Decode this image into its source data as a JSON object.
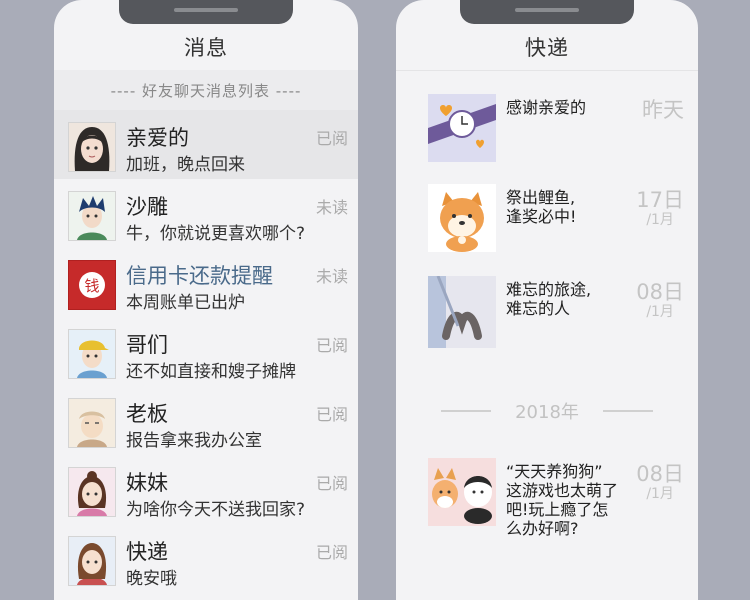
{
  "left_phone": {
    "title": "消息",
    "subtitle": "---- 好友聊天消息列表 ----",
    "items": [
      {
        "name": "亲爱的",
        "preview": "加班，晚点回来",
        "status": "已阅"
      },
      {
        "name": "沙雕",
        "preview": "牛，你就说更喜欢哪个?",
        "status": "未读"
      },
      {
        "name": "信用卡还款提醒",
        "preview": "本周账单已出炉",
        "status": "未读"
      },
      {
        "name": "哥们",
        "preview": "还不如直接和嫂子摊牌",
        "status": "已阅"
      },
      {
        "name": "老板",
        "preview": "报告拿来我办公室",
        "status": "已阅"
      },
      {
        "name": "妹妹",
        "preview": "为啥你今天不送我回家?",
        "status": "已阅"
      },
      {
        "name": "快递",
        "preview": "晚安哦",
        "status": "已阅"
      }
    ],
    "bank_icon_char": "钱"
  },
  "right_phone": {
    "title": "快递",
    "messages": [
      {
        "lines": [
          "感谢亲爱的"
        ],
        "day": "昨天",
        "month": ""
      },
      {
        "lines": [
          "祭出鲤鱼,",
          "逢奖必中!"
        ],
        "day": "17日",
        "month": "/1月"
      },
      {
        "lines": [
          "难忘的旅途,",
          "难忘的人"
        ],
        "day": "08日",
        "month": "/1月"
      },
      {
        "lines": [
          "“天天养狗狗”",
          "这游戏也太萌了",
          "吧!玩上瘾了怎",
          "么办好啊?"
        ],
        "day": "08日",
        "month": "/1月"
      }
    ],
    "divider_year": "2018年"
  },
  "colors": {
    "background": "#a9acb8",
    "screen": "#f3f3f5",
    "highlight_row": "#e6e6e8",
    "bank_red": "#c62a2a",
    "muted_text": "#aaaaaa"
  },
  "icons": [
    "girlfriend-avatar",
    "friend-avatar",
    "bank-icon",
    "buddy-avatar",
    "boss-avatar",
    "sister-avatar",
    "courier-avatar",
    "watch-gift-thumb",
    "shiba-dog-thumb",
    "holding-hands-thumb",
    "cat-dog-game-thumb"
  ]
}
